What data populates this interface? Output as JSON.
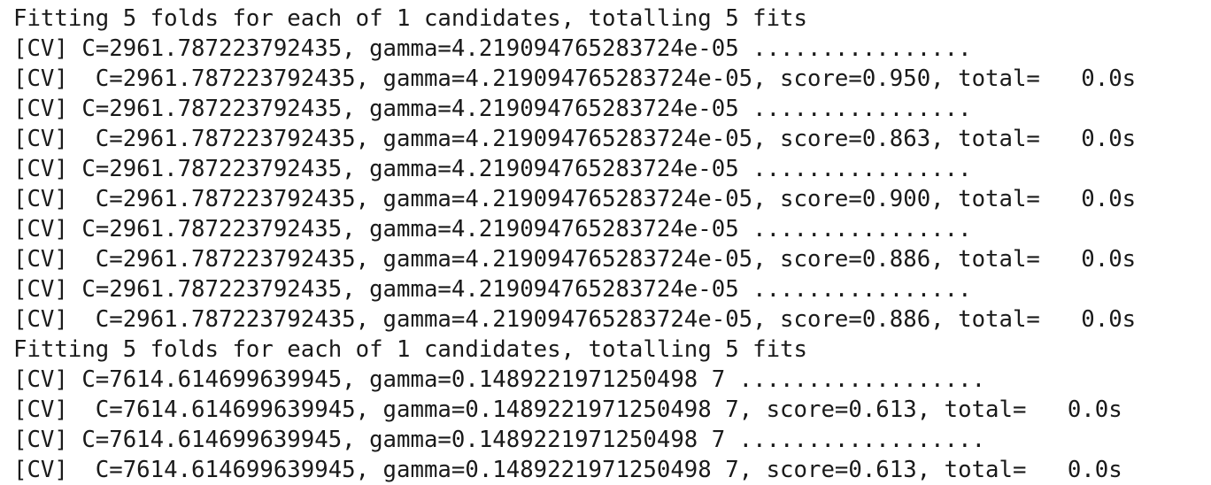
{
  "output_lines": [
    "Fitting 5 folds for each of 1 candidates, totalling 5 fits",
    "[CV] C=2961.787223792435, gamma=4.219094765283724e-05 ................",
    "[CV]  C=2961.787223792435, gamma=4.219094765283724e-05, score=0.950, total=   0.0s",
    "[CV] C=2961.787223792435, gamma=4.219094765283724e-05 ................",
    "[CV]  C=2961.787223792435, gamma=4.219094765283724e-05, score=0.863, total=   0.0s",
    "[CV] C=2961.787223792435, gamma=4.219094765283724e-05 ................",
    "[CV]  C=2961.787223792435, gamma=4.219094765283724e-05, score=0.900, total=   0.0s",
    "[CV] C=2961.787223792435, gamma=4.219094765283724e-05 ................",
    "[CV]  C=2961.787223792435, gamma=4.219094765283724e-05, score=0.886, total=   0.0s",
    "[CV] C=2961.787223792435, gamma=4.219094765283724e-05 ................",
    "[CV]  C=2961.787223792435, gamma=4.219094765283724e-05, score=0.886, total=   0.0s",
    "Fitting 5 folds for each of 1 candidates, totalling 5 fits",
    "[CV] C=7614.614699639945, gamma=0.1489221971250498 7 ..................",
    "[CV]  C=7614.614699639945, gamma=0.1489221971250498 7, score=0.613, total=   0.0s",
    "[CV] C=7614.614699639945, gamma=0.1489221971250498 7 ..................",
    "[CV]  C=7614.614699639945, gamma=0.1489221971250498 7, score=0.613, total=   0.0s"
  ]
}
